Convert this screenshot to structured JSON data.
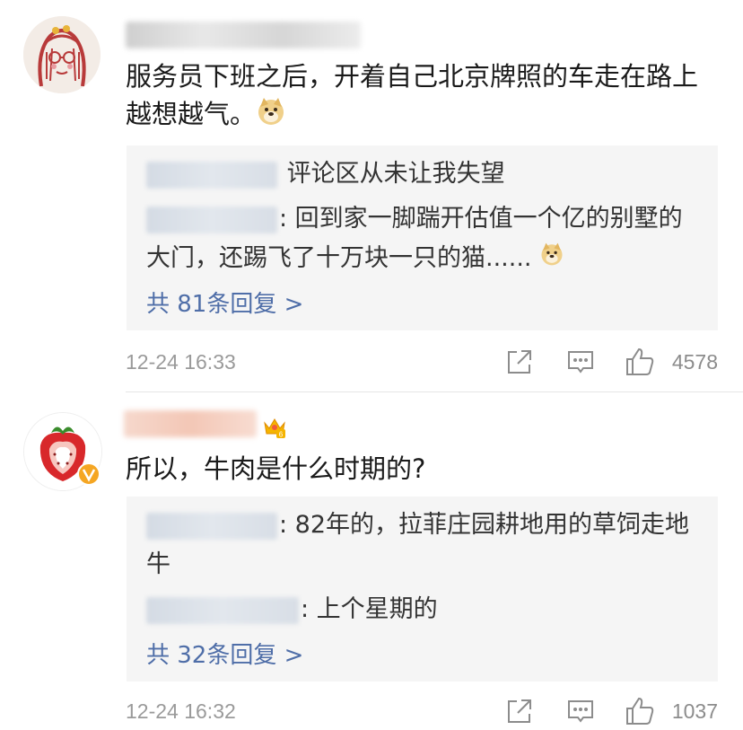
{
  "comments": [
    {
      "content": "服务员下班之后，开着自己北京牌照的车走在路上越想越气。",
      "emoji": "doge-emoji",
      "replies": [
        {
          "text": "评论区从未让我失望"
        },
        {
          "text": ": 回到家一脚踹开估值一个亿的别墅的大门，还踢飞了十万块一只的猫......"
        }
      ],
      "more_replies": "共 81条回复 >",
      "time": "12-24 16:33",
      "likes": "4578"
    },
    {
      "content": "所以，牛肉是什么时期的?",
      "replies": [
        {
          "text": ": 82年的，拉菲庄园耕地用的草饲走地牛"
        },
        {
          "text": ": 上个星期的"
        }
      ],
      "more_replies": "共 32条回复 >",
      "time": "12-24 16:32",
      "likes": "1037",
      "badge_level": "6"
    }
  ],
  "icons": {
    "share": "share-icon",
    "comment": "comment-icon",
    "like": "thumbs-up-icon"
  },
  "colors": {
    "link": "#4f6ea8",
    "reply_bg": "#f5f5f5",
    "meta_text": "#9a9a9a"
  }
}
